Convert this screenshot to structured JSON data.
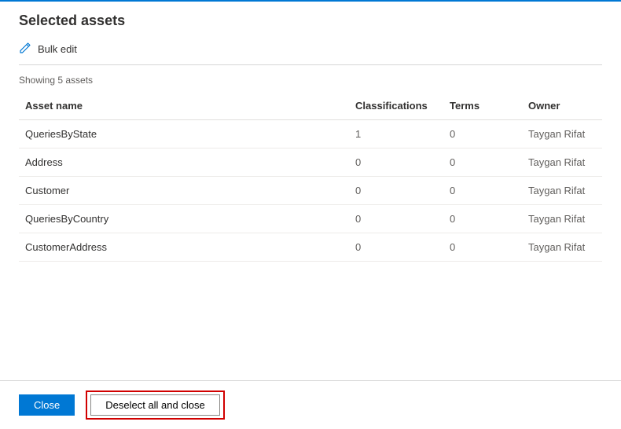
{
  "header": {
    "title": "Selected assets"
  },
  "toolbar": {
    "bulk_edit_label": "Bulk edit"
  },
  "count_text": "Showing 5 assets",
  "columns": {
    "asset_name": "Asset name",
    "classifications": "Classifications",
    "terms": "Terms",
    "owner": "Owner"
  },
  "rows": [
    {
      "name": "QueriesByState",
      "classifications": "1",
      "classifications_is_link": true,
      "terms": "0",
      "owner": "Taygan Rifat"
    },
    {
      "name": "Address",
      "classifications": "0",
      "classifications_is_link": false,
      "terms": "0",
      "owner": "Taygan Rifat"
    },
    {
      "name": "Customer",
      "classifications": "0",
      "classifications_is_link": false,
      "terms": "0",
      "owner": "Taygan Rifat"
    },
    {
      "name": "QueriesByCountry",
      "classifications": "0",
      "classifications_is_link": false,
      "terms": "0",
      "owner": "Taygan Rifat"
    },
    {
      "name": "CustomerAddress",
      "classifications": "0",
      "classifications_is_link": false,
      "terms": "0",
      "owner": "Taygan Rifat"
    }
  ],
  "footer": {
    "close_label": "Close",
    "deselect_label": "Deselect all and close"
  }
}
